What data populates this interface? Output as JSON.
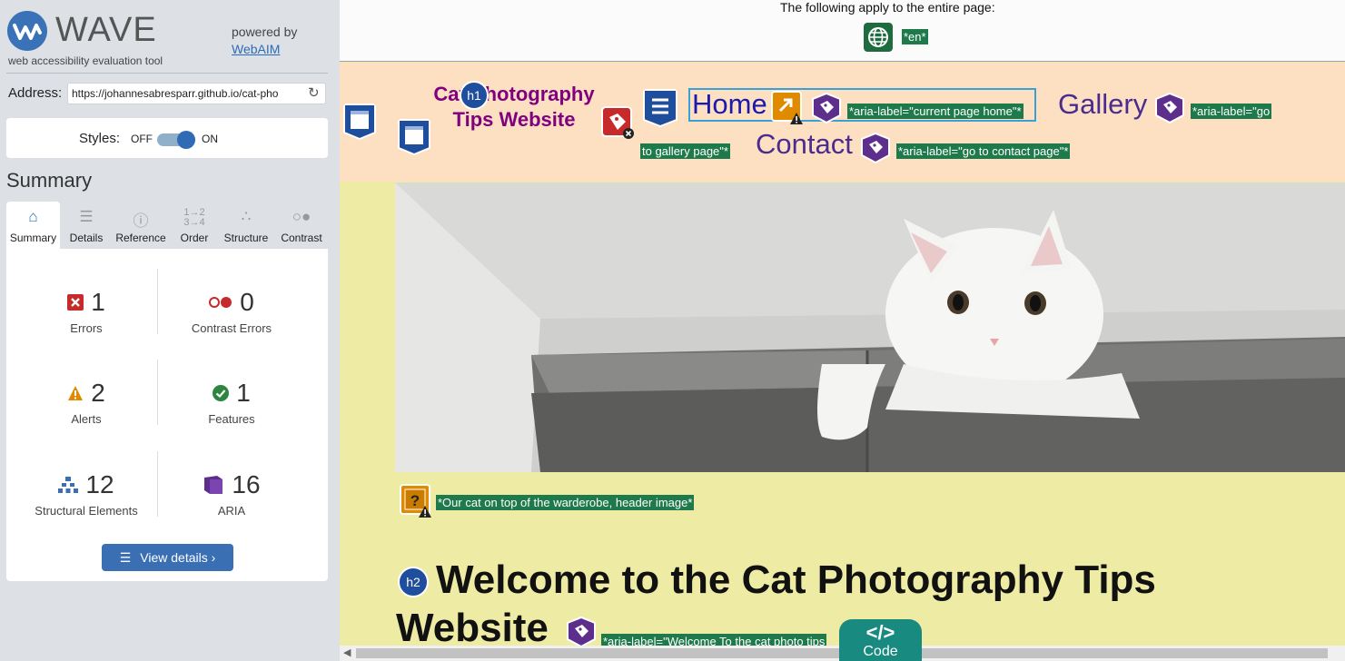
{
  "app": {
    "name": "WAVE",
    "subtitle": "web accessibility evaluation tool",
    "powered_by": "powered by",
    "powered_link": "WebAIM"
  },
  "address": {
    "label": "Address:",
    "value": "https://johannesabresparr.github.io/cat-pho"
  },
  "styles": {
    "label": "Styles:",
    "off": "OFF",
    "on": "ON",
    "state": "on"
  },
  "summary": {
    "heading": "Summary",
    "tabs": [
      {
        "label": "Summary",
        "icon": "home-icon",
        "active": true
      },
      {
        "label": "Details",
        "icon": "list-icon",
        "active": false
      },
      {
        "label": "Reference",
        "icon": "info-icon",
        "active": false
      },
      {
        "label": "Order",
        "icon": "order-icon",
        "active": false
      },
      {
        "label": "Structure",
        "icon": "structure-icon",
        "active": false
      },
      {
        "label": "Contrast",
        "icon": "contrast-icon",
        "active": false
      }
    ],
    "stats": {
      "errors": {
        "count": "1",
        "label": "Errors",
        "color": "#c62a2a"
      },
      "contrast_errors": {
        "count": "0",
        "label": "Contrast Errors",
        "color": "#c62a2a"
      },
      "alerts": {
        "count": "2",
        "label": "Alerts",
        "color": "#e08a00"
      },
      "features": {
        "count": "1",
        "label": "Features",
        "color": "#2e8540"
      },
      "structural": {
        "count": "12",
        "label": "Structural Elements",
        "color": "#3a6fb3"
      },
      "aria": {
        "count": "16",
        "label": "ARIA",
        "color": "#5d2e8c"
      }
    },
    "view_details": "View details ›"
  },
  "page": {
    "apply_text": "The following apply to the entire page:",
    "lang_tag": "*en*",
    "site_title": "Cat Photography Tips Website",
    "nav": {
      "home": "Home",
      "gallery": "Gallery",
      "contact": "Contact"
    },
    "aria_home": "*aria-label=\"current page home\"*",
    "aria_gallery_1": "*aria-label=\"go",
    "aria_gallery_2": "to gallery page\"*",
    "aria_contact": "*aria-label=\"go to contact page\"*",
    "alt_text": "*Our cat on top of the warderobe, header image*",
    "h2_line1": "Welcome to the Cat Photography Tips",
    "h2_line2": "Website",
    "aria_welcome": "*aria-label=\"Welcome To the cat photo tips",
    "icon_labels": {
      "h1": "h1",
      "h2": "h2"
    }
  },
  "code_tab": {
    "glyph": "</>",
    "label": "Code"
  }
}
